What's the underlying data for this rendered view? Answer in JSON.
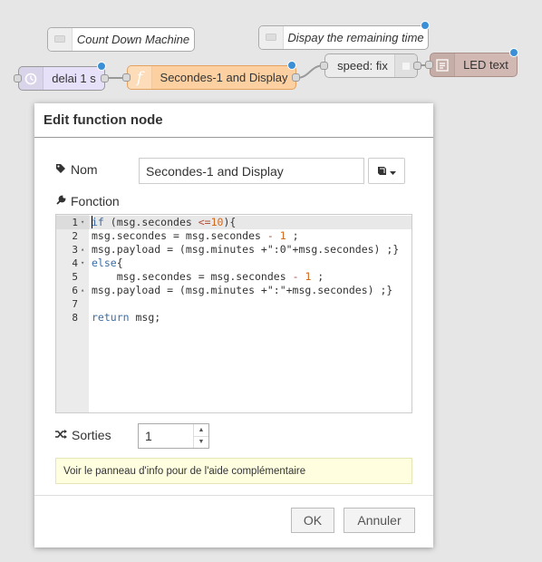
{
  "nodes": {
    "comment_countdown": "Count Down Machine",
    "comment_display": "Dispay the remaining time",
    "delay": "delai 1 s",
    "function": "Secondes-1 and Display",
    "speed": "speed: fix",
    "led": "LED text"
  },
  "colors": {
    "function_node": "#fdd0a2",
    "function_border": "#e4a15f",
    "delay_node": "#e6e0f8",
    "speed_node": "#ececec",
    "led_node": "#d1b8b2",
    "changed_dot": "#3a8fd6",
    "info_bg": "#ffffe0"
  },
  "icons": {
    "delay": "timer-icon",
    "function": "function-icon",
    "led": "text-display-icon",
    "comment": "comment-icon",
    "name": "tag-icon",
    "function_label": "wrench-icon",
    "outputs": "shuffle-icon",
    "library": "book-icon"
  },
  "dialog": {
    "title": "Edit function node",
    "name_label": "Nom",
    "name_value": "Secondes-1 and Display",
    "function_label": "Fonction",
    "outputs_label": "Sorties",
    "outputs_value": "1",
    "info_text": "Voir le panneau d'info pour de l'aide complémentaire",
    "ok_label": "OK",
    "cancel_label": "Annuler"
  },
  "code": {
    "active_line": 1,
    "lines": [
      {
        "n": "1",
        "fold": "▾",
        "text": "if (msg.secondes <=10){"
      },
      {
        "n": "2",
        "fold": "",
        "text": "msg.secondes = msg.secondes - 1 ;"
      },
      {
        "n": "3",
        "fold": "▴",
        "text": "msg.payload = (msg.minutes +\":0\"+msg.secondes) ;}"
      },
      {
        "n": "4",
        "fold": "▾",
        "text": "else{"
      },
      {
        "n": "5",
        "fold": "",
        "text": "    msg.secondes = msg.secondes - 1 ;"
      },
      {
        "n": "6",
        "fold": "▴",
        "text": "msg.payload = (msg.minutes +\":\"+msg.secondes) ;}"
      },
      {
        "n": "7",
        "fold": "",
        "text": ""
      },
      {
        "n": "8",
        "fold": "",
        "text": "return msg;"
      }
    ]
  }
}
